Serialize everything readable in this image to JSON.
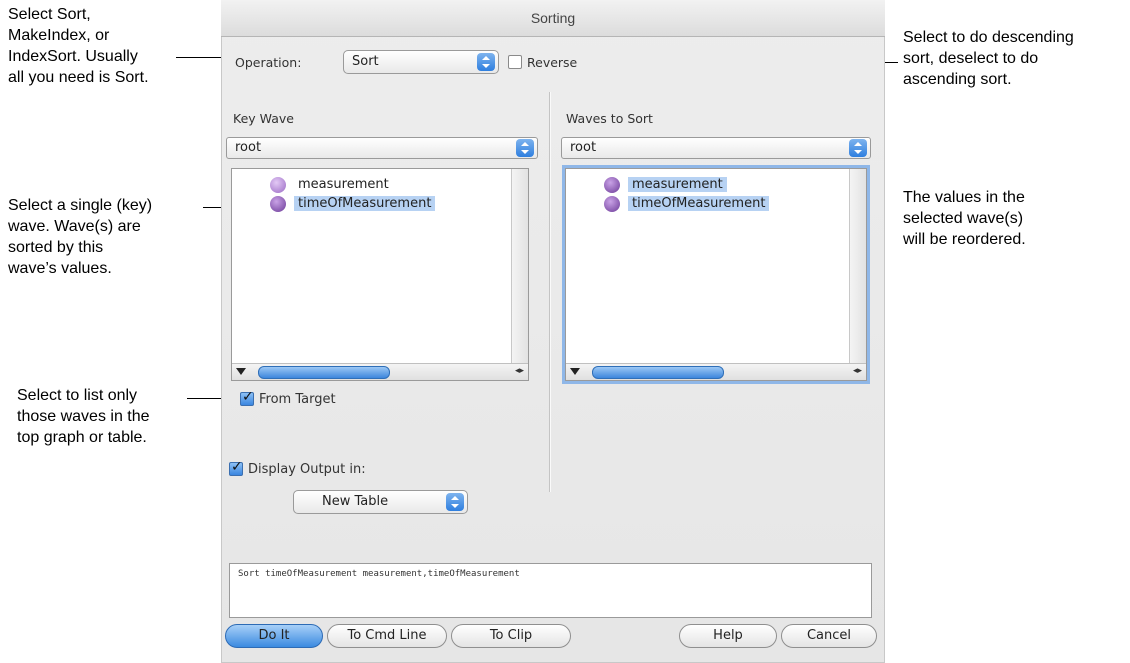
{
  "dialog": {
    "title": "Sorting",
    "operation_label": "Operation:",
    "operation_value": "Sort",
    "reverse_label": "Reverse",
    "key_wave_label": "Key Wave",
    "key_wave_folder": "root",
    "waves_to_sort_label": "Waves to Sort",
    "waves_to_sort_folder": "root",
    "key_wave_items": [
      "measurement",
      "timeOfMeasurement"
    ],
    "waves_to_sort_items": [
      "measurement",
      "timeOfMeasurement"
    ],
    "from_target_label": "From Target",
    "display_output_label": "Display Output in:",
    "display_output_value": "New Table",
    "command_text": "Sort timeOfMeasurement measurement,timeOfMeasurement",
    "buttons": {
      "do_it": "Do It",
      "to_cmd_line": "To Cmd Line",
      "to_clip": "To Clip",
      "help": "Help",
      "cancel": "Cancel"
    }
  },
  "state": {
    "reverse_checked": false,
    "from_target_checked": true,
    "display_output_checked": true
  },
  "annotations": {
    "operation": [
      "Select Sort,",
      "MakeIndex, or",
      "IndexSort. Usually",
      "all you need is Sort."
    ],
    "key_wave": [
      "Select a single (key)",
      "wave. Wave(s) are",
      "sorted by this",
      "wave’s values."
    ],
    "from_target": [
      "Select to list only",
      "those waves in the",
      "top graph or table."
    ],
    "reverse": [
      "Select to do descending",
      "sort, deselect to do",
      "ascending sort."
    ],
    "waves_to_sort": [
      "The values in the",
      "selected wave(s)",
      "will be reordered."
    ]
  }
}
